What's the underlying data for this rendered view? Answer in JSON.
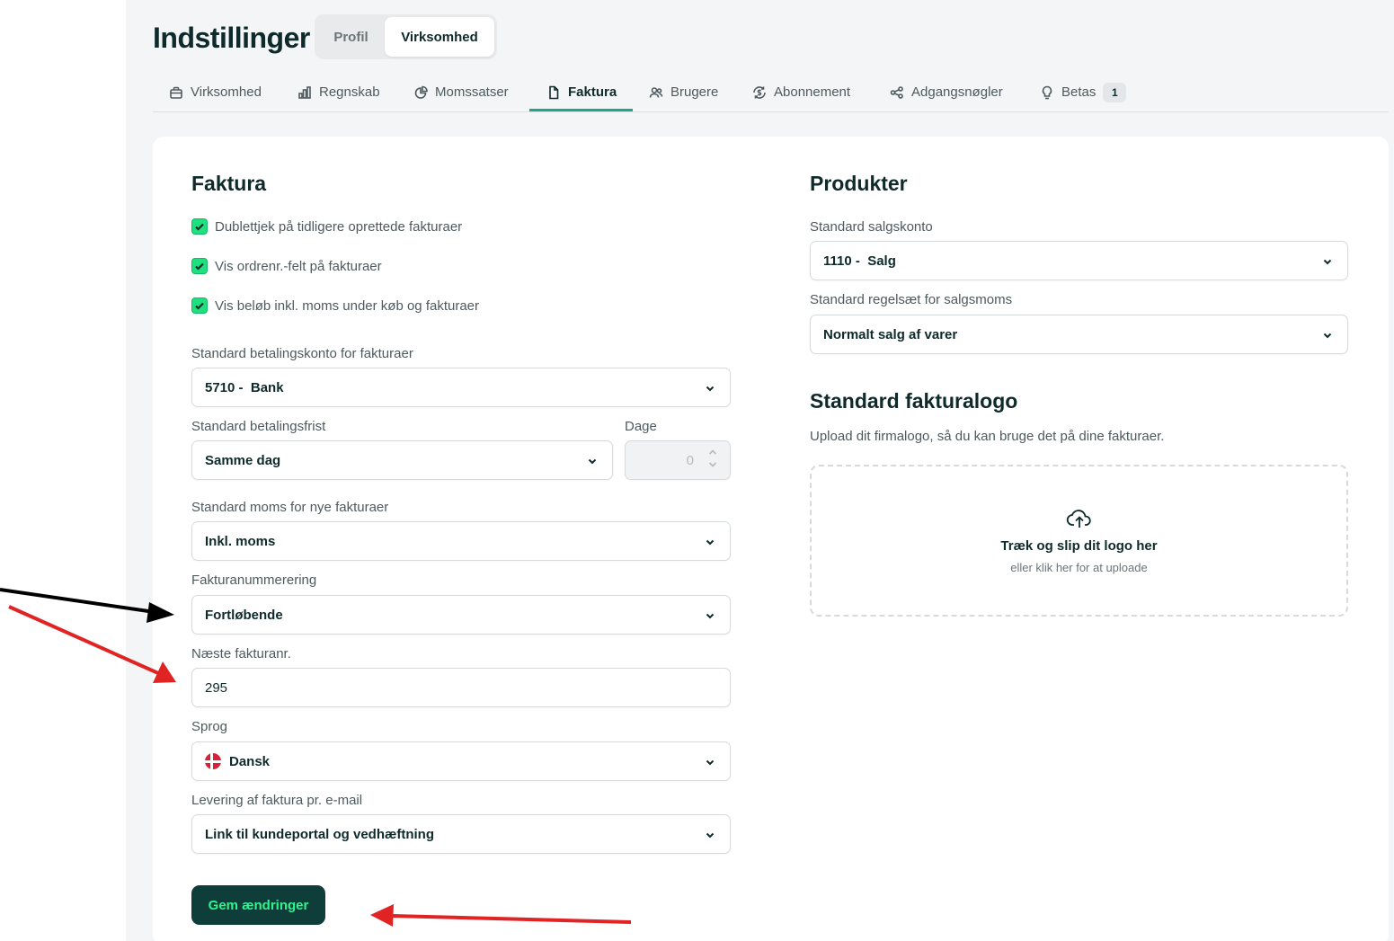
{
  "header": {
    "title": "Indstillinger",
    "segments": [
      "Profil",
      "Virksomhed"
    ],
    "active_segment": "Virksomhed"
  },
  "tabs": [
    {
      "label": "Virksomhed",
      "icon": "briefcase-icon"
    },
    {
      "label": "Regnskab",
      "icon": "bar-chart-icon"
    },
    {
      "label": "Momssatser",
      "icon": "pie-chart-icon"
    },
    {
      "label": "Faktura",
      "icon": "document-icon",
      "active": true
    },
    {
      "label": "Brugere",
      "icon": "users-icon"
    },
    {
      "label": "Abonnement",
      "icon": "dollar-cycle-icon"
    },
    {
      "label": "Adgangsnøgler",
      "icon": "share-nodes-icon"
    },
    {
      "label": "Betas",
      "icon": "lightbulb-icon",
      "badge": "1"
    }
  ],
  "faktura": {
    "heading": "Faktura",
    "checkboxes": [
      {
        "label": "Dublettjek på tidligere oprettede fakturaer",
        "checked": true
      },
      {
        "label": "Vis ordrenr.-felt på fakturaer",
        "checked": true
      },
      {
        "label": "Vis beløb inkl. moms under køb og fakturaer",
        "checked": true
      }
    ],
    "payment_account": {
      "label": "Standard betalingskonto for fakturaer",
      "value": "5710 -  Bank"
    },
    "payment_term": {
      "label": "Standard betalingsfrist",
      "value": "Samme dag"
    },
    "days": {
      "label": "Dage",
      "value": "0"
    },
    "vat": {
      "label": "Standard moms for nye fakturaer",
      "value": "Inkl. moms"
    },
    "numbering": {
      "label": "Fakturanummerering",
      "value": "Fortløbende"
    },
    "next_number": {
      "label": "Næste fakturanr.",
      "value": "295"
    },
    "language": {
      "label": "Sprog",
      "value": "Dansk"
    },
    "delivery": {
      "label": "Levering af faktura pr. e-mail",
      "value": "Link til kundeportal og vedhæftning"
    },
    "save_label": "Gem ændringer"
  },
  "produkter": {
    "heading": "Produkter",
    "sales_account": {
      "label": "Standard salgskonto",
      "value": "1110 -  Salg"
    },
    "vat_rules": {
      "label": "Standard regelsæt for salgsmoms",
      "value": "Normalt salg af varer"
    }
  },
  "logo": {
    "heading": "Standard fakturalogo",
    "description": "Upload dit firmalogo, så du kan bruge det på dine fakturaer.",
    "drop_title": "Træk og slip dit logo her",
    "drop_sub": "eller klik her for at uploade"
  },
  "colors": {
    "accent": "#1aa886",
    "checkbox": "#1fe07f",
    "button_bg": "#0f3d3a",
    "button_text": "#2ff58e",
    "annotation_black": "#000000",
    "annotation_red": "#e02424"
  }
}
